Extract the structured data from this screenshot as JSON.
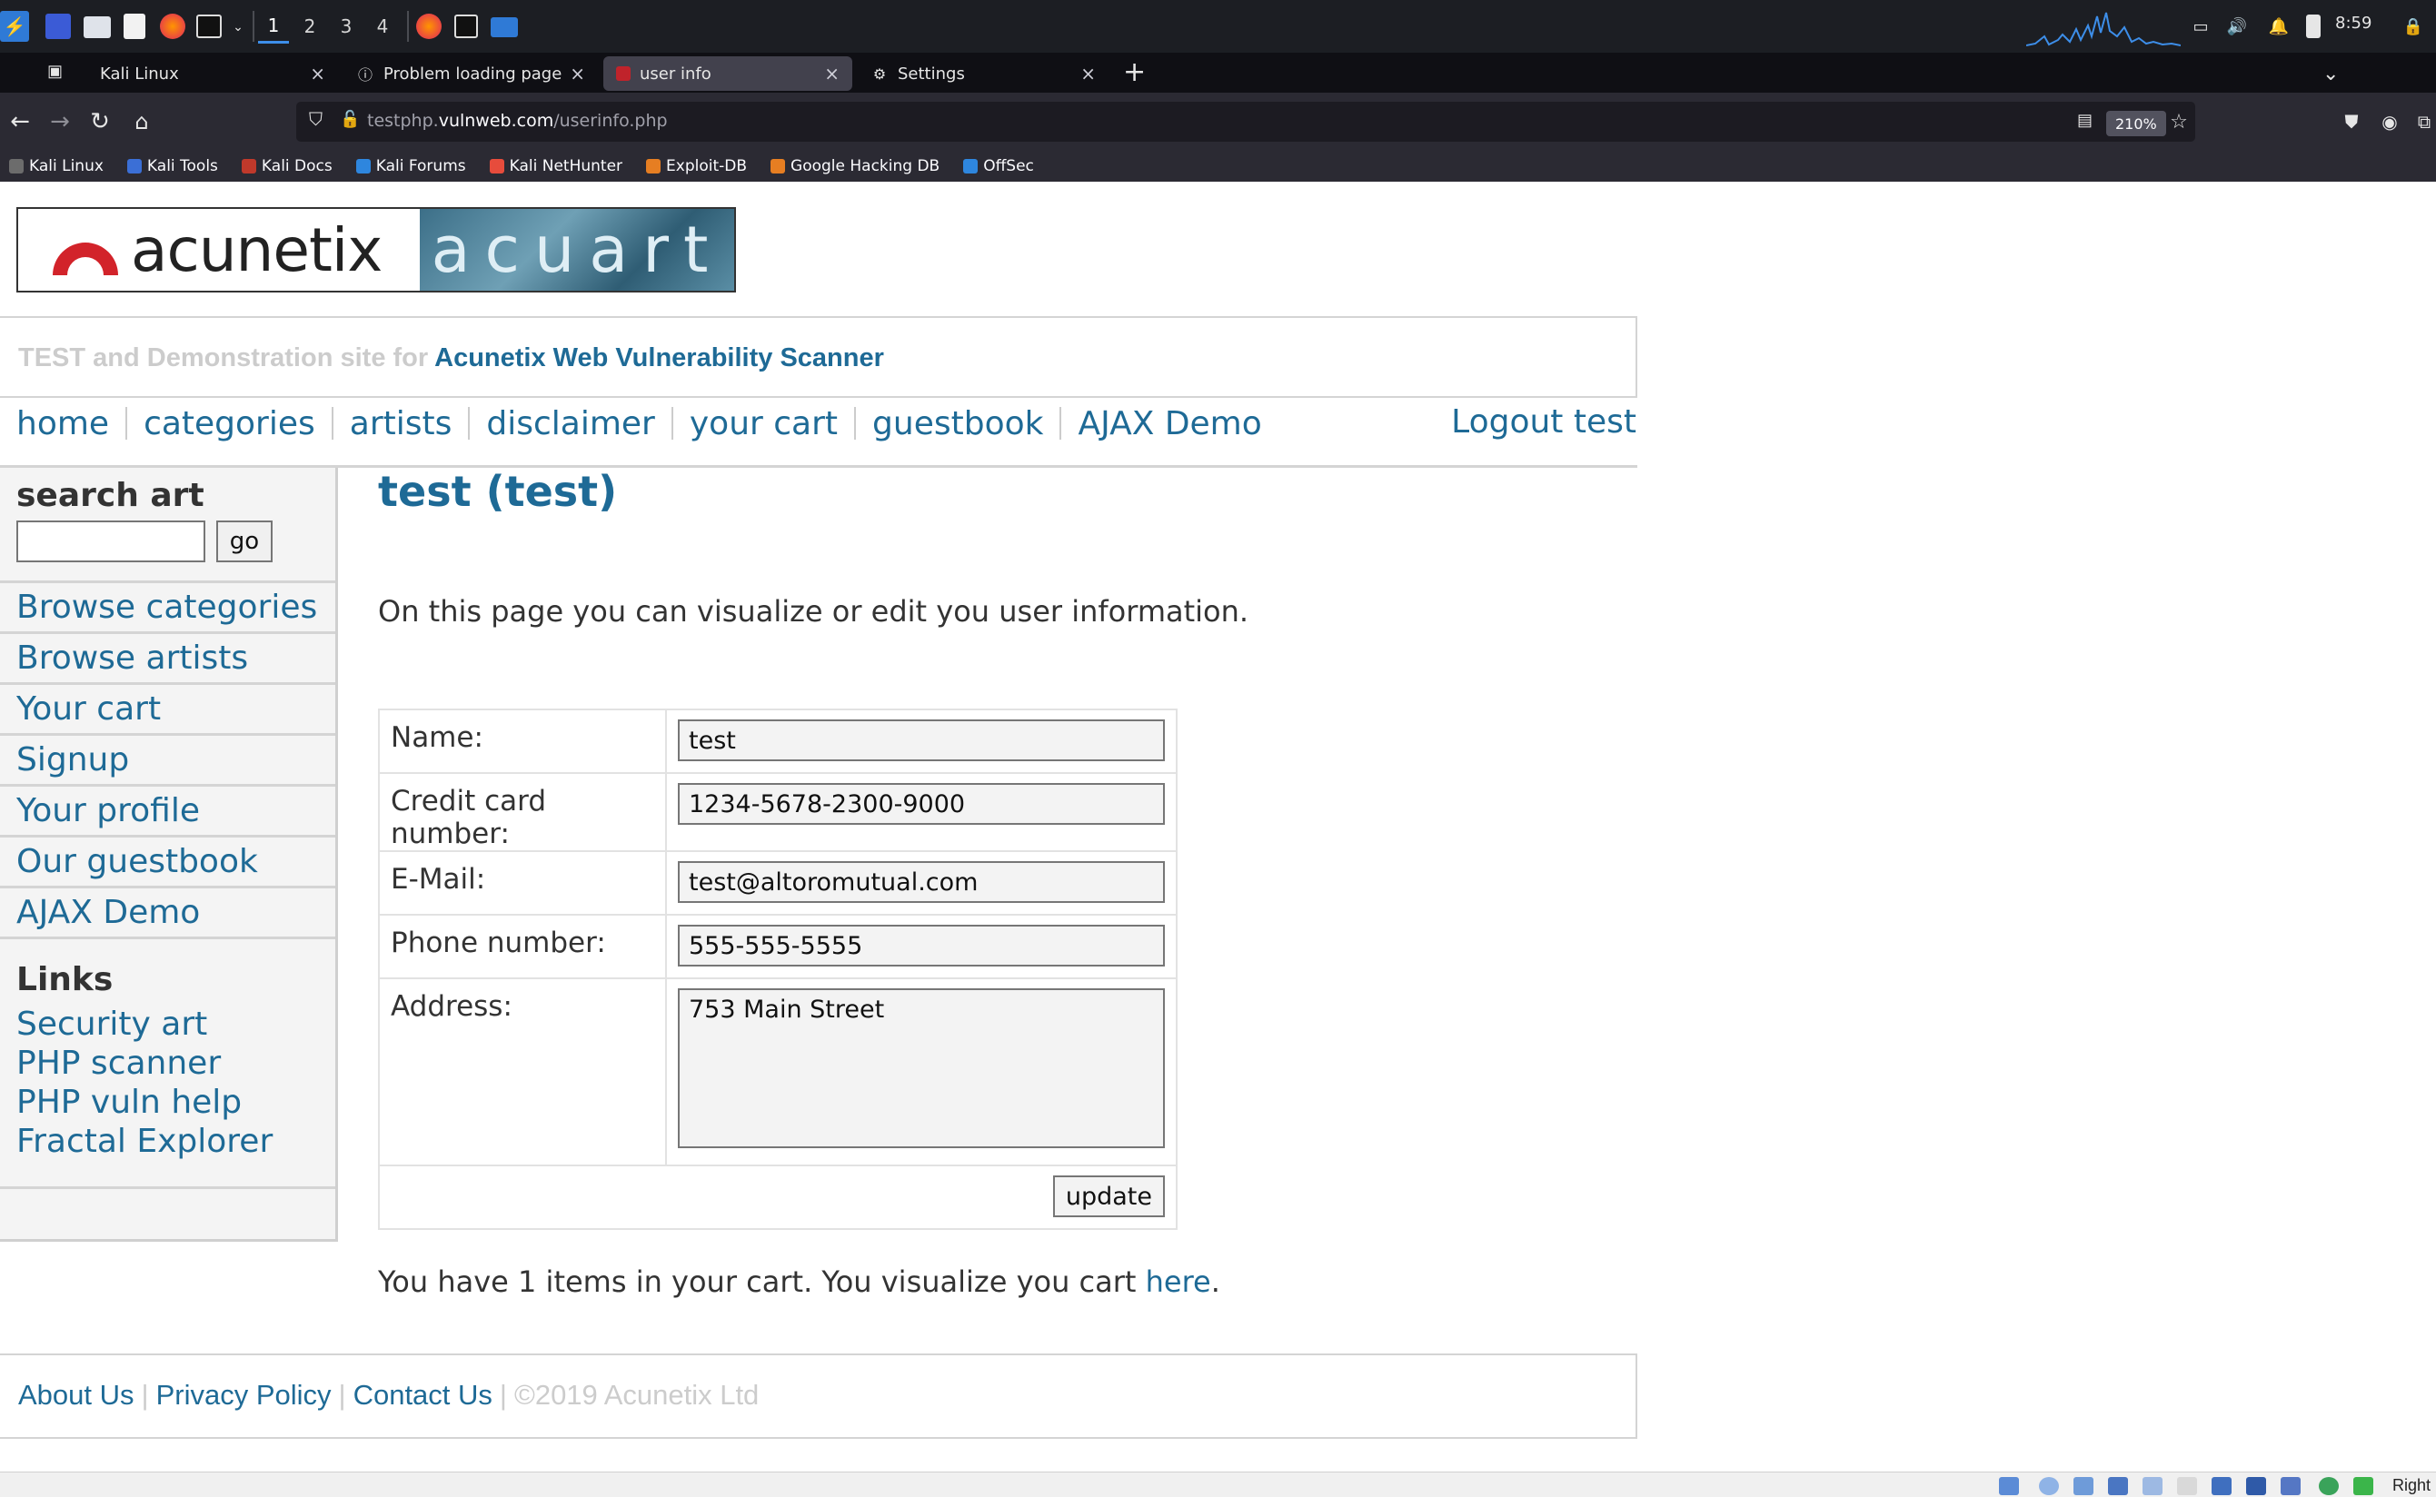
{
  "taskbar": {
    "workspaces": [
      "1",
      "2",
      "3",
      "4"
    ],
    "clock": "8:59"
  },
  "tabs": [
    {
      "label": "Kali Linux"
    },
    {
      "label": "Problem loading page"
    },
    {
      "label": "user info"
    },
    {
      "label": "Settings"
    }
  ],
  "navbar": {
    "url_prefix": "testphp.",
    "url_host": "vulnweb.com",
    "url_path": "/userinfo.php",
    "zoom": "210%"
  },
  "bookmarks": [
    {
      "label": "Kali Linux",
      "color": "#6c6c6c"
    },
    {
      "label": "Kali Tools",
      "color": "#3b6fd6"
    },
    {
      "label": "Kali Docs",
      "color": "#c0392b"
    },
    {
      "label": "Kali Forums",
      "color": "#2e86de"
    },
    {
      "label": "Kali NetHunter",
      "color": "#e74c3c"
    },
    {
      "label": "Exploit-DB",
      "color": "#e67e22"
    },
    {
      "label": "Google Hacking DB",
      "color": "#e67e22"
    },
    {
      "label": "OffSec",
      "color": "#2e86de"
    }
  ],
  "site": {
    "logo_left": "acunetix",
    "logo_right": "acuart",
    "tagline_prefix": "TEST and Demonstration site for ",
    "tagline_strong": "Acunetix Web Vulnerability Scanner",
    "nav": [
      "home",
      "categories",
      "artists",
      "disclaimer",
      "your cart",
      "guestbook",
      "AJAX Demo"
    ],
    "logout": "Logout test",
    "accent_color": "#1e6a96"
  },
  "sidebar": {
    "search_title": "search art",
    "search_value": "",
    "go_label": "go",
    "links": [
      "Browse categories",
      "Browse artists",
      "Your cart",
      "Signup",
      "Your profile",
      "Our guestbook",
      "AJAX Demo"
    ],
    "links_title": "Links",
    "external_links": [
      "Security art",
      "PHP scanner",
      "PHP vuln help",
      "Fractal Explorer"
    ]
  },
  "main": {
    "heading": "test (test)",
    "intro": "On this page you can visualize or edit you user information.",
    "form": {
      "name_label": "Name:",
      "name_value": "test",
      "cc_label": "Credit card number:",
      "cc_value": "1234-5678-2300-9000",
      "email_label": "E-Mail:",
      "email_value": "test@altoromutual.com",
      "phone_label": "Phone number:",
      "phone_value": "555-555-5555",
      "address_label": "Address:",
      "address_value": "753 Main Street",
      "update_label": "update"
    },
    "cart_text": "You have 1 items in your cart. You visualize you cart ",
    "cart_link": "here",
    "cart_end": "."
  },
  "footer": {
    "links": [
      "About Us",
      "Privacy Policy",
      "Contact Us"
    ],
    "copyright": "©2019 Acunetix Ltd"
  },
  "vm_strip": {
    "host_key": "Right"
  }
}
